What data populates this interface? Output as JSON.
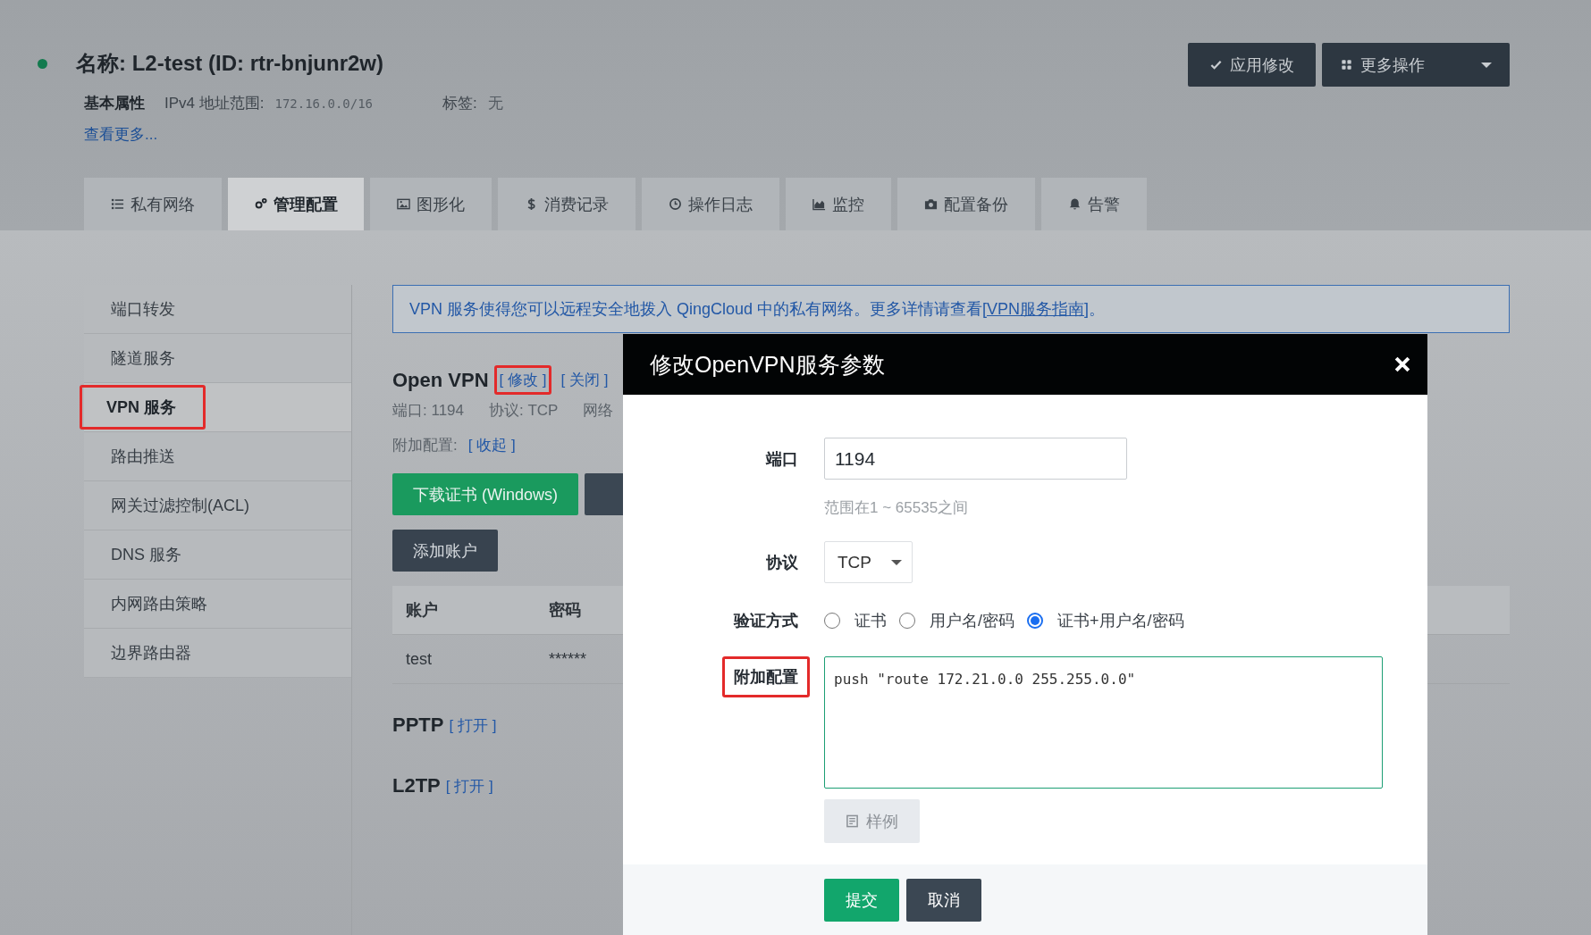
{
  "title": "名称: L2-test (ID: rtr-bnjunr2w)",
  "actions": [
    {
      "label": "应用修改",
      "kind": "check",
      "dropdown": false
    },
    {
      "label": "更多操作",
      "kind": "grid",
      "dropdown": true
    }
  ],
  "properties": {
    "heading": "基本属性",
    "fields": [
      {
        "label": "IPv4 地址范围:",
        "value": "172.16.0.0/16"
      },
      {
        "label": "标签:",
        "value": "无"
      }
    ],
    "more_link": "查看更多..."
  },
  "tabs": [
    {
      "label": "私有网络",
      "kind": "list",
      "selected": false
    },
    {
      "label": "管理配置",
      "kind": "gears",
      "selected": true
    },
    {
      "label": "图形化",
      "kind": "image",
      "selected": false
    },
    {
      "label": "消费记录",
      "kind": "dollar",
      "selected": false
    },
    {
      "label": "操作日志",
      "kind": "clock",
      "selected": false
    },
    {
      "label": "监控",
      "kind": "area",
      "selected": false
    },
    {
      "label": "配置备份",
      "kind": "camera",
      "selected": false
    },
    {
      "label": "告警",
      "kind": "bell",
      "selected": false
    }
  ],
  "sidebar": [
    {
      "label": "端口转发",
      "selected": false,
      "highlighted": false
    },
    {
      "label": "隧道服务",
      "selected": false,
      "highlighted": false
    },
    {
      "label": "VPN 服务",
      "selected": true,
      "highlighted": true
    },
    {
      "label": "路由推送",
      "selected": false,
      "highlighted": false
    },
    {
      "label": "网关过滤控制(ACL)",
      "selected": false,
      "highlighted": false
    },
    {
      "label": "DNS 服务",
      "selected": false,
      "highlighted": false
    },
    {
      "label": "内网路由策略",
      "selected": false,
      "highlighted": false
    },
    {
      "label": "边界路由器",
      "selected": false,
      "highlighted": false
    }
  ],
  "notice": {
    "text": "VPN 服务使得您可以远程安全地拨入 QingCloud 中的私有网络。更多详情请查看",
    "link": "[VPN服务指南]",
    "end": "。"
  },
  "openvpn": {
    "title": "Open VPN",
    "links": [
      {
        "label": "[ 修改 ]",
        "highlighted": true
      },
      {
        "label": "[ 关闭 ]",
        "highlighted": false
      }
    ],
    "info": [
      "端口: 1194",
      "协议: TCP",
      "网络"
    ],
    "extra_label": "附加配置:",
    "extra_link": "[ 收起 ]",
    "buttons": [
      {
        "label": "下载证书 (Windows)",
        "kind": "primary"
      },
      {
        "kind": "secondary"
      }
    ],
    "add_account": "添加账户",
    "table": {
      "columns": [
        "账户",
        "密码"
      ],
      "rows": [
        [
          "test",
          "******"
        ]
      ]
    }
  },
  "services": [
    {
      "title": "PPTP",
      "link": "[ 打开 ]"
    },
    {
      "title": "L2TP",
      "link": "[ 打开 ]"
    }
  ],
  "dialog": {
    "title": "修改OpenVPN服务参数",
    "port": {
      "label": "端口",
      "value": "1194",
      "hint": "范围在1 ~ 65535之间"
    },
    "protocol": {
      "label": "协议",
      "value": "TCP"
    },
    "auth": {
      "label": "验证方式",
      "options": [
        {
          "label": "证书",
          "selected": false
        },
        {
          "label": "用户名/密码",
          "selected": false
        },
        {
          "label": "证书+用户名/密码",
          "selected": true
        }
      ]
    },
    "extra": {
      "label": "附加配置",
      "highlighted": true,
      "value": "push \"route 172.21.0.0 255.255.0.0\"\n"
    },
    "sample_button": "样例",
    "buttons": [
      {
        "label": "提交",
        "kind": "primary"
      },
      {
        "label": "取消",
        "kind": "secondary"
      }
    ]
  }
}
